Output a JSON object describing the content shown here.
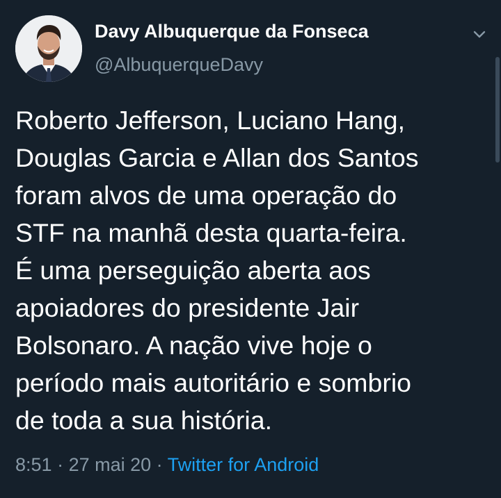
{
  "tweet": {
    "author_name": "Davy Albuquerque da Fonseca",
    "author_handle": "@AlbuquerqueDavy",
    "text_lines": [
      "Roberto Jefferson, Luciano Hang,",
      "Douglas Garcia e Allan dos Santos",
      "foram alvos de uma operação do",
      "STF na manhã desta quarta-feira.",
      "É uma perseguição aberta aos",
      "apoiadores do presidente Jair",
      "Bolsonaro. A nação vive hoje o",
      "período mais autoritário e sombrio",
      "de toda a sua história."
    ],
    "time": "8:51",
    "separator": " · ",
    "date": "27 mai 20",
    "source": "Twitter for Android"
  },
  "icons": {
    "caret": "chevron-down-icon",
    "avatar": "avatar"
  },
  "colors": {
    "background": "#15202b",
    "primary_text": "#ffffff",
    "secondary_text": "#8899a6",
    "link": "#1da1f2"
  }
}
